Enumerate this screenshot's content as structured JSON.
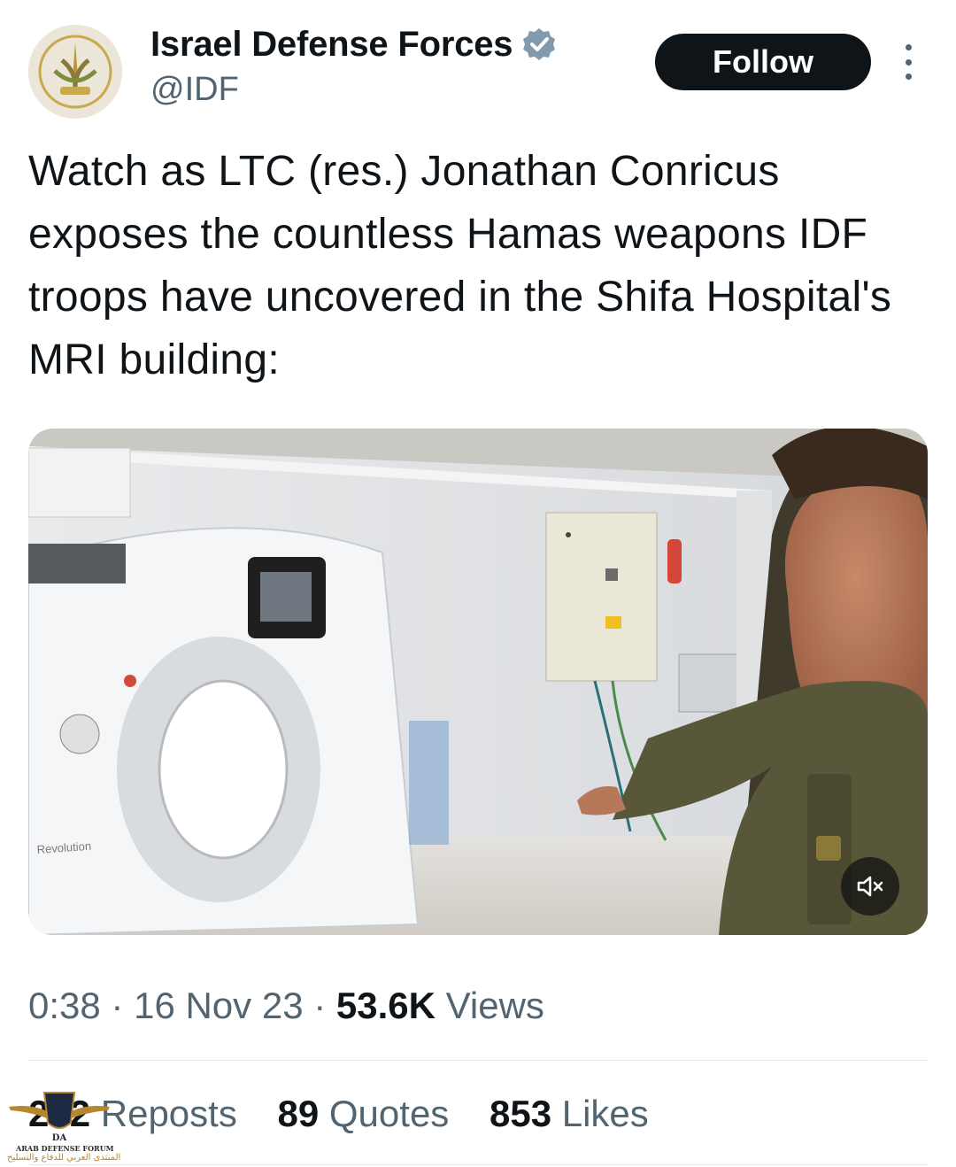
{
  "author": {
    "display_name": "Israel Defense Forces",
    "handle": "@IDF",
    "verified": true,
    "avatar_icon": "idf-emblem-icon"
  },
  "actions": {
    "follow_label": "Follow",
    "more_icon": "more-vertical-icon"
  },
  "tweet": {
    "text": "Watch as LTC (res.) Jonathan Conricus exposes the countless Hamas weapons IDF troops have uncovered in the Shifa Hospital's MRI building:"
  },
  "media": {
    "type": "video",
    "scanner_label": "Revolution",
    "mute_icon": "speaker-muted-icon"
  },
  "meta": {
    "duration": "0:38",
    "separator": "·",
    "date": "16 Nov 23",
    "views_count": "53.6K",
    "views_label": "Views"
  },
  "stats": {
    "reposts_count": "272",
    "reposts_label": "Reposts",
    "quotes_count": "89",
    "quotes_label": "Quotes",
    "likes_count": "853",
    "likes_label": "Likes"
  },
  "watermark": {
    "badge": "DA",
    "line1": "ARAB DEFENSE FORUM",
    "line2": "المنتدى العربي للدفاع والتسليح"
  },
  "colors": {
    "text_primary": "#0f1419",
    "text_secondary": "#536471",
    "verified_badge": "#829aab",
    "follow_bg": "#0f1419",
    "divider": "#e1e6ea"
  }
}
